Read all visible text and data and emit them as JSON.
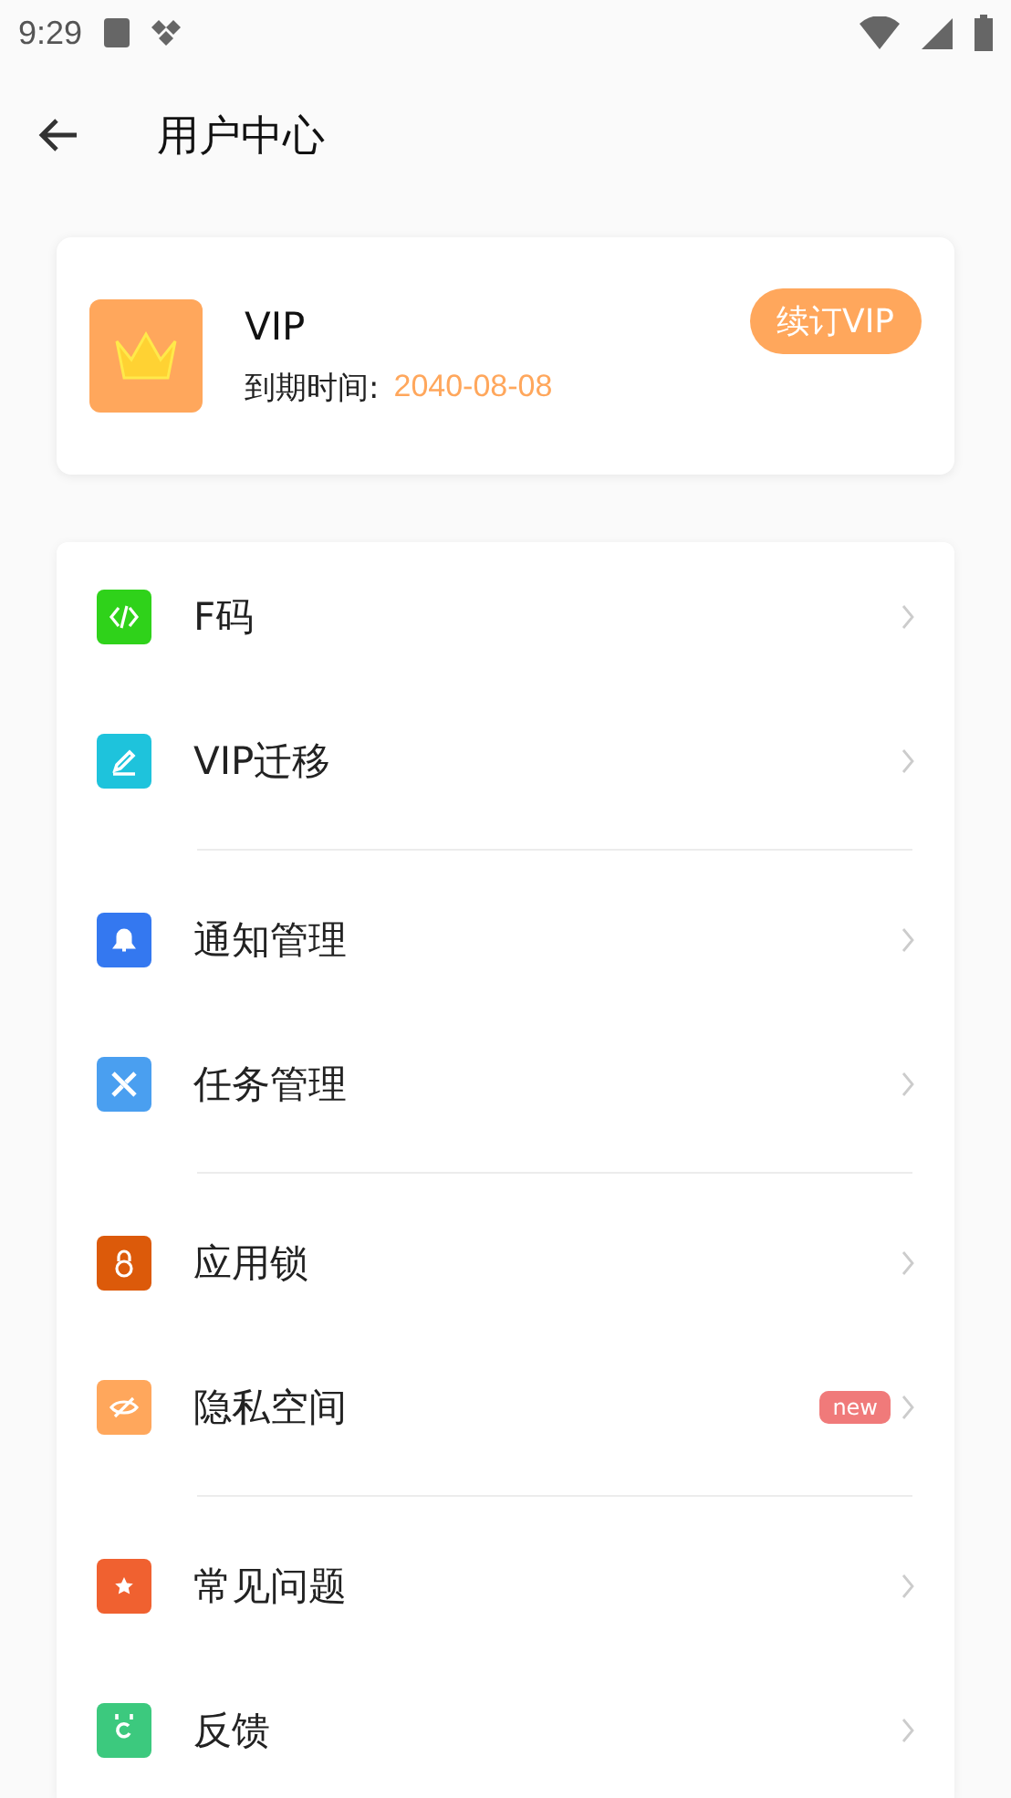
{
  "status_bar": {
    "time": "9:29"
  },
  "header": {
    "title": "用户中心"
  },
  "vip_card": {
    "title": "VIP",
    "expiry_label": "到期时间:",
    "expiry_date": "2040-08-08",
    "renew_button": "续订VIP"
  },
  "menu_groups": [
    [
      {
        "label": "F码",
        "kind": "code",
        "color": "#2fd21a"
      },
      {
        "label": "VIP迁移",
        "kind": "edit",
        "color": "#1ec3dc"
      }
    ],
    [
      {
        "label": "通知管理",
        "kind": "bell",
        "color": "#3478f0"
      },
      {
        "label": "任务管理",
        "kind": "tools",
        "color": "#4a9ff0"
      }
    ],
    [
      {
        "label": "应用锁",
        "kind": "lock",
        "color": "#dc5a0a"
      },
      {
        "label": "隐私空间",
        "kind": "eye",
        "color": "#ffa75c",
        "badge": "new"
      }
    ],
    [
      {
        "label": "常见问题",
        "kind": "star",
        "color": "#f06130"
      },
      {
        "label": "反馈",
        "kind": "calendar",
        "color": "#3cc97e"
      }
    ]
  ]
}
